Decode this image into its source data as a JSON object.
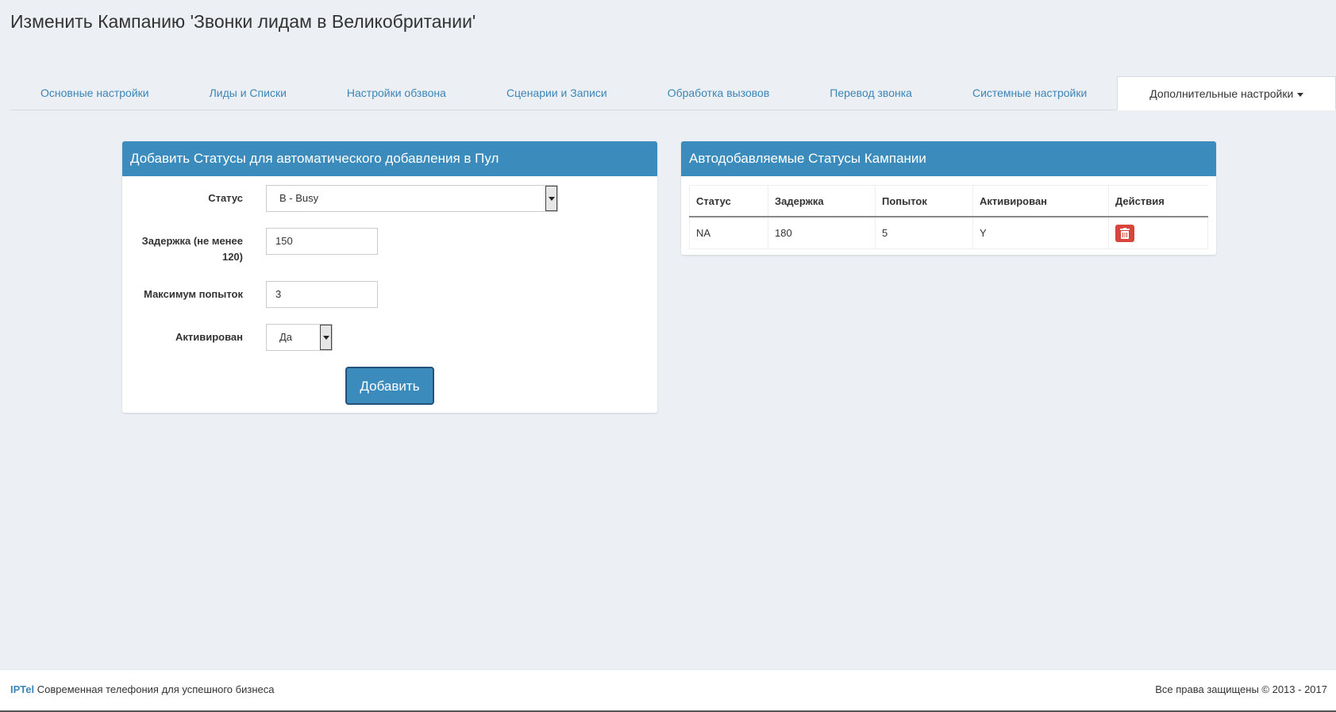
{
  "page": {
    "title": "Изменить Кампанию 'Звонки лидам в Великобритании'"
  },
  "tabs": [
    {
      "label": "Основные настройки"
    },
    {
      "label": "Лиды и Списки"
    },
    {
      "label": "Настройки обзвона"
    },
    {
      "label": "Сценарии и Записи"
    },
    {
      "label": "Обработка вызовов"
    },
    {
      "label": "Перевод звонка"
    },
    {
      "label": "Системные настройки"
    },
    {
      "label": "Дополнительные настройки",
      "active": true
    }
  ],
  "add_form": {
    "heading": "Добавить Статусы для автоматического добавления в Пул",
    "status_label": "Статус",
    "status_value": "B - Busy",
    "delay_label": "Задержка (не менее 120)",
    "delay_value": "150",
    "max_attempts_label": "Максимум попыток",
    "max_attempts_value": "3",
    "active_label": "Активирован",
    "active_value": "Да",
    "submit_label": "Добавить"
  },
  "statuses_table": {
    "heading": "Автодобавляемые Статусы Кампании",
    "columns": [
      "Статус",
      "Задержка",
      "Попыток",
      "Активирован",
      "Действия"
    ],
    "rows": [
      {
        "status": "NA",
        "delay": "180",
        "attempts": "5",
        "active": "Y",
        "action_icon": "trash-icon"
      }
    ]
  },
  "footer": {
    "brand": "IPTel",
    "tagline": "Современная телефония для успешного бизнеса",
    "copyright": "Все права защищены © 2013 - 2017"
  },
  "colors": {
    "accent": "#3b8bbd",
    "link": "#3b86b8",
    "danger": "#d9453a",
    "background": "#eceff3"
  }
}
